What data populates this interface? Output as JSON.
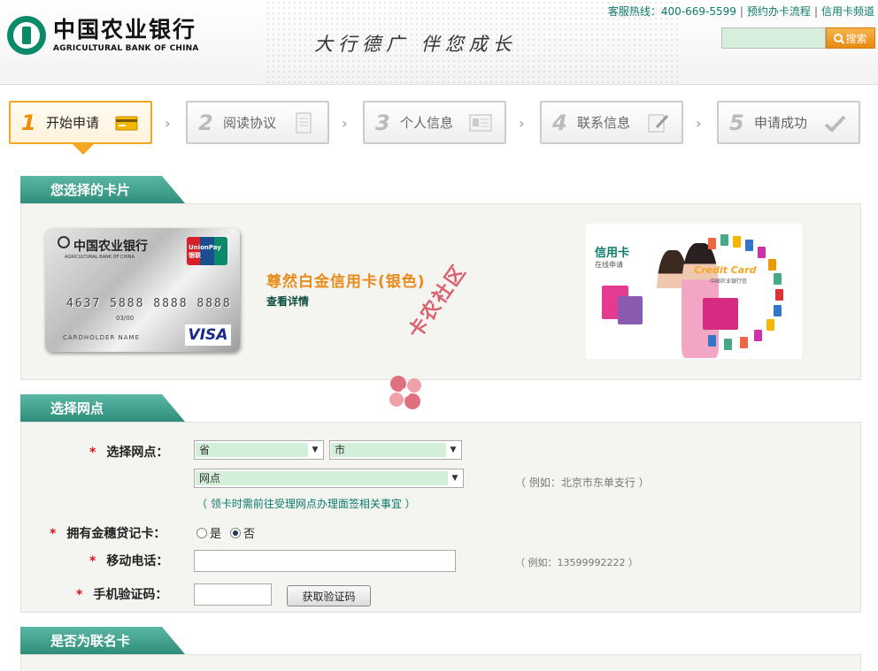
{
  "header": {
    "bank_name_cn": "中国农业银行",
    "bank_name_en": "AGRICULTURAL BANK OF CHINA",
    "slogan": "大行德广 伴您成长",
    "hotline": "客服热线：400-669-5599",
    "link_process": "预约办卡流程",
    "link_channel": "信用卡频道",
    "search_value": "",
    "search_button": "搜索"
  },
  "steps": [
    {
      "num": "1",
      "label": "开始申请",
      "icon": "credit-card-icon",
      "active": true
    },
    {
      "num": "2",
      "label": "阅读协议",
      "icon": "document-icon",
      "active": false
    },
    {
      "num": "3",
      "label": "个人信息",
      "icon": "id-card-icon",
      "active": false
    },
    {
      "num": "4",
      "label": "联系信息",
      "icon": "edit-icon",
      "active": false
    },
    {
      "num": "5",
      "label": "申请成功",
      "icon": "checkmark-icon",
      "active": false
    }
  ],
  "card_section": {
    "tab": "您选择的卡片",
    "card_name": "尊然白金信用卡(银色)",
    "details_link": "查看详情",
    "card_face": {
      "bank": "中国农业银行",
      "bank_en": "AGRICULTURAL BANK OF CHINA",
      "unionpay": "UnionPay 银联",
      "number": "4637 5888 8888 8888",
      "expiry": "03/00",
      "holder": "CARDHOLDER NAME",
      "brand": "VISA"
    },
    "promo": {
      "title": "信用卡",
      "subtitle": "在线申请",
      "credit_card": "Credit Card",
      "bank": "中国农业银行信"
    }
  },
  "branch_section": {
    "tab": "选择网点",
    "branch_label": "选择网点：",
    "province": "省",
    "city": "市",
    "branch": "网点",
    "branch_hint": "（ 例如：北京市东单支行 ）",
    "branch_note": "（ 领卡时需前往受理网点办理面签相关事宜 ）",
    "debit_label": "拥有金穗贷记卡：",
    "debit_yes": "是",
    "debit_no": "否",
    "mobile_label": "移动电话：",
    "mobile_value": "",
    "mobile_hint": "（ 例如：13599992222 ）",
    "sms_label": "手机验证码：",
    "sms_value": "",
    "sms_button": "获取验证码"
  },
  "cobrand_section": {
    "tab": "是否为联名卡"
  },
  "watermark": {
    "text": "卡农社区"
  },
  "colors": {
    "brand_green": "#2f8e7b",
    "accent_orange": "#f5a623",
    "card_name_orange": "#e98b1a",
    "required_red": "#dd1111"
  }
}
